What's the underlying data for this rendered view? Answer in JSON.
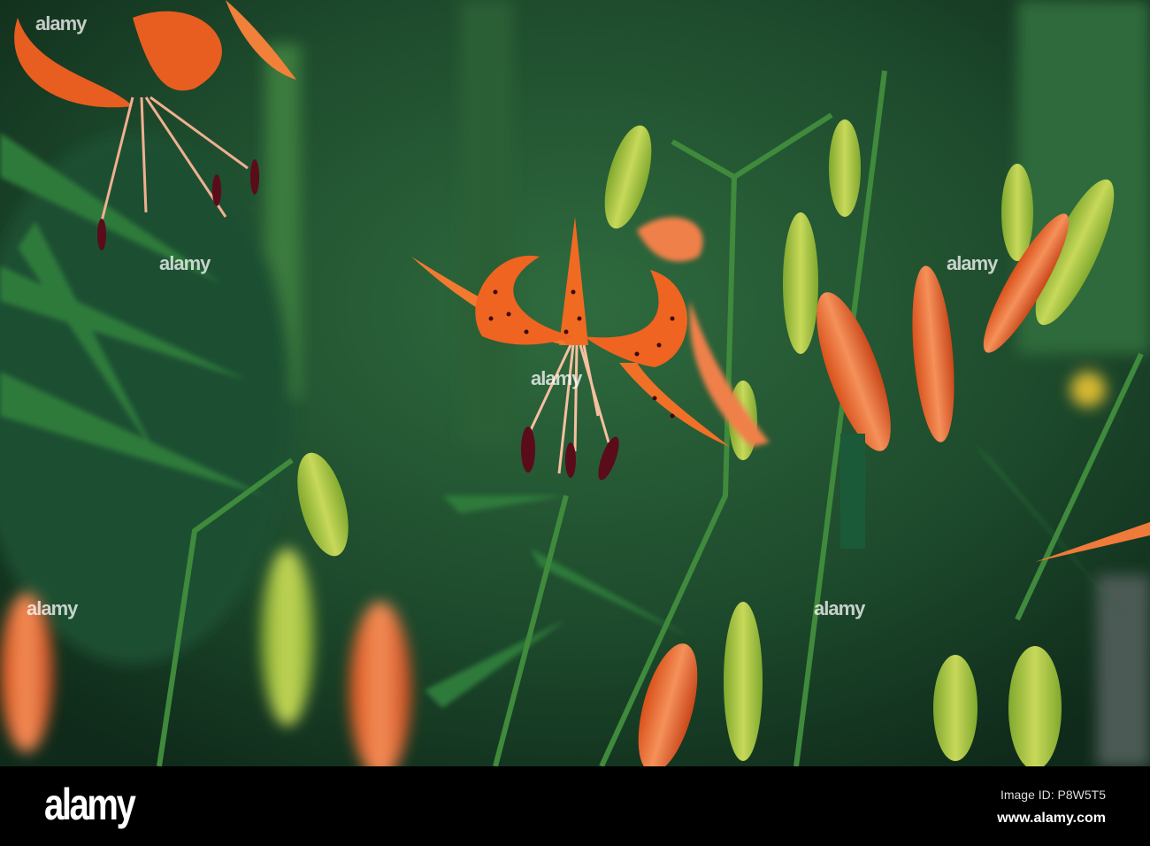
{
  "photo": {
    "subject": "orange tiger lily with buds",
    "colors": {
      "background": "#1d4a2c",
      "leaf": "#2f7a3a",
      "petal": "#f06a22",
      "bud": "#a6c640",
      "spot": "#3a0a0a"
    }
  },
  "watermark": {
    "text": "alamy"
  },
  "footer": {
    "logo": "alamy",
    "image_id": "Image ID: P8W5T5",
    "website": "www.alamy.com"
  }
}
